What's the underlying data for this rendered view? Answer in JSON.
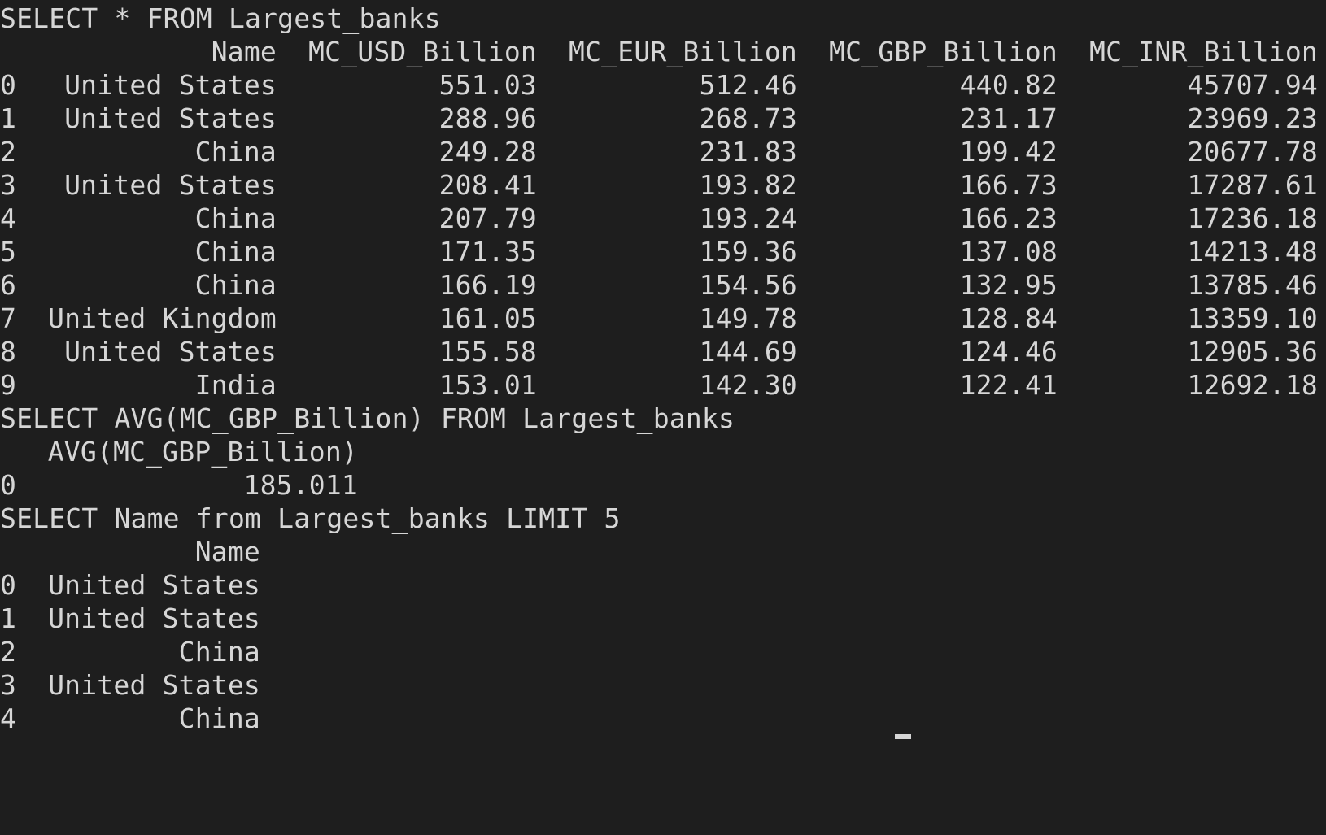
{
  "terminal": {
    "query1": {
      "command": "SELECT * FROM Largest_banks",
      "headers": [
        "Name",
        "MC_USD_Billion",
        "MC_EUR_Billion",
        "MC_GBP_Billion",
        "MC_INR_Billion"
      ],
      "rows": [
        {
          "index": "0",
          "name": "United States",
          "usd": "551.03",
          "eur": "512.46",
          "gbp": "440.82",
          "inr": "45707.94"
        },
        {
          "index": "1",
          "name": "United States",
          "usd": "288.96",
          "eur": "268.73",
          "gbp": "231.17",
          "inr": "23969.23"
        },
        {
          "index": "2",
          "name": "China",
          "usd": "249.28",
          "eur": "231.83",
          "gbp": "199.42",
          "inr": "20677.78"
        },
        {
          "index": "3",
          "name": "United States",
          "usd": "208.41",
          "eur": "193.82",
          "gbp": "166.73",
          "inr": "17287.61"
        },
        {
          "index": "4",
          "name": "China",
          "usd": "207.79",
          "eur": "193.24",
          "gbp": "166.23",
          "inr": "17236.18"
        },
        {
          "index": "5",
          "name": "China",
          "usd": "171.35",
          "eur": "159.36",
          "gbp": "137.08",
          "inr": "14213.48"
        },
        {
          "index": "6",
          "name": "China",
          "usd": "166.19",
          "eur": "154.56",
          "gbp": "132.95",
          "inr": "13785.46"
        },
        {
          "index": "7",
          "name": "United Kingdom",
          "usd": "161.05",
          "eur": "149.78",
          "gbp": "128.84",
          "inr": "13359.10"
        },
        {
          "index": "8",
          "name": "United States",
          "usd": "155.58",
          "eur": "144.69",
          "gbp": "124.46",
          "inr": "12905.36"
        },
        {
          "index": "9",
          "name": "India",
          "usd": "153.01",
          "eur": "142.30",
          "gbp": "122.41",
          "inr": "12692.18"
        }
      ]
    },
    "query2": {
      "command": "SELECT AVG(MC_GBP_Billion) FROM Largest_banks",
      "header": "AVG(MC_GBP_Billion)",
      "rows": [
        {
          "index": "0",
          "value": "185.011"
        }
      ]
    },
    "query3": {
      "command": "SELECT Name from Largest_banks LIMIT 5",
      "header": "Name",
      "rows": [
        {
          "index": "0",
          "name": "United States"
        },
        {
          "index": "1",
          "name": "United States"
        },
        {
          "index": "2",
          "name": "China"
        },
        {
          "index": "3",
          "name": "United States"
        },
        {
          "index": "4",
          "name": "China"
        }
      ]
    }
  }
}
